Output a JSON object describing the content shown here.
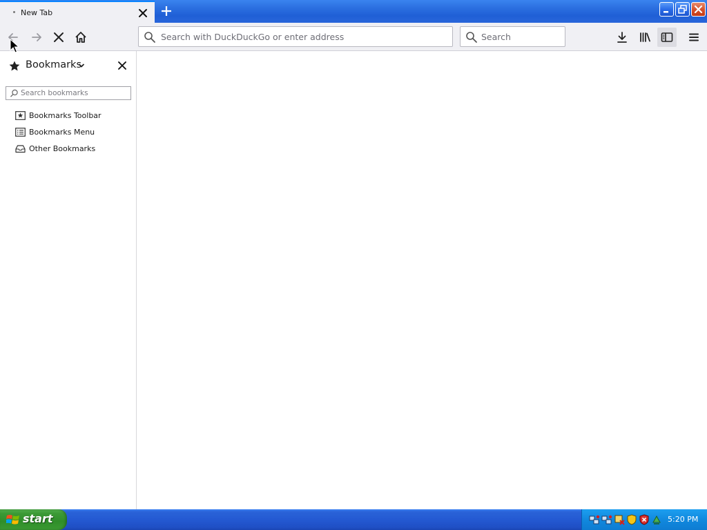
{
  "tab": {
    "title": "New Tab"
  },
  "navbar": {
    "url_placeholder": "Search with DuckDuckGo or enter address",
    "search_placeholder": "Search"
  },
  "sidebar": {
    "title": "Bookmarks",
    "search_placeholder": "Search bookmarks",
    "items": [
      {
        "label": "Bookmarks Toolbar",
        "icon": "bookmarks-toolbar-icon"
      },
      {
        "label": "Bookmarks Menu",
        "icon": "bookmarks-menu-icon"
      },
      {
        "label": "Other Bookmarks",
        "icon": "other-bookmarks-icon"
      }
    ]
  },
  "taskbar": {
    "start_label": "start",
    "clock": "5:20 PM"
  },
  "colors": {
    "xp_title_blue": "#2b6fe0",
    "tab_accent": "#0a84ff",
    "start_green": "#3c9a36",
    "tray_blue": "#1189de"
  }
}
